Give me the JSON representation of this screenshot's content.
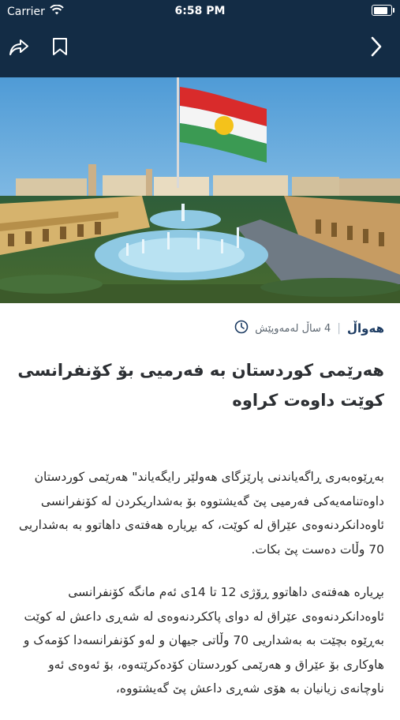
{
  "status_bar": {
    "carrier": "Carrier",
    "time": "6:58 PM",
    "battery_level": 0.95
  },
  "toolbar": {
    "share_icon": "share-icon",
    "bookmark_icon": "bookmark-icon",
    "next_icon": "chevron-right-icon"
  },
  "article": {
    "hero_image": "city-fountain-kurdistan-flag",
    "meta": {
      "category": "هەواڵ",
      "time_ago": "4 ساڵ لەمەوپێش",
      "clock_icon": "clock-icon"
    },
    "title": "هەرێمی کوردستان بە فەرمیی بۆ کۆنفرانسی کوێت داوەت کراوە",
    "paragraphs": [
      "بەڕێوەبەری ڕاگەیاندنی پارێزگای هەولێر رایگەیاند\" هەرێمی کوردستان داوەتنامەیەکی فەرمیی پێ گەیشتووە بۆ بەشداریکردن لە کۆنفرانسی ئاوەدانکردنەوەی عێراق لە کوێت، کە بڕیارە هەفتەی داهاتوو بە بەشداریی 70 وڵات دەست پێ بکات.",
      "بڕیارە هەفتەی داهاتوو ڕۆژی 12 تا 14ی ئەم مانگە کۆنفرانسی ئاوەدانکردنەوەی عێراق لە دوای پاککردنەوەی لە شەڕی داعش لە کوێت بەڕێوە بچێت بە بەشداریی 70 وڵاتی جیهان و لەو کۆنفرانسەدا کۆمەک و هاوکاری بۆ عێراق و هەرێمی کوردستان کۆدەکرێتەوە، بۆ ئەوەی ئەو ناوچانەی زیانیان بە هۆی شەڕی داعش پێ گەیشتووە،"
    ]
  }
}
